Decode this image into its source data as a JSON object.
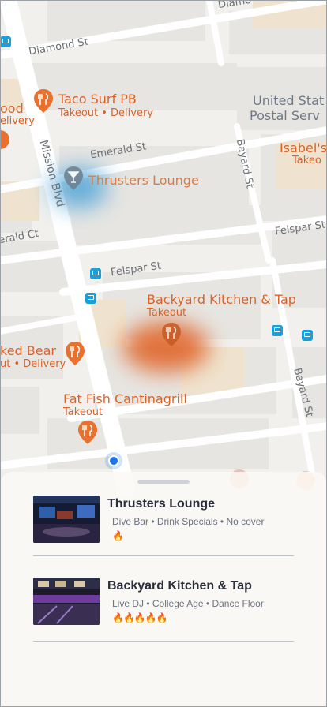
{
  "map": {
    "streets": {
      "diamond_top": "Diamo",
      "diamond": "Diamond St",
      "emerald": "Emerald St",
      "emerald_left": "erald Ct",
      "felspar": "Felspar St",
      "felspar_right": "Felspar St",
      "mission": "Mission Blvd",
      "bayard_top": "Bayard St",
      "bayard_bottom": "Bayard St"
    },
    "places": {
      "taco_surf": {
        "name": "Taco Surf PB",
        "sub": "Takeout • Delivery"
      },
      "usps": {
        "line1": "United Stat",
        "line2": "Postal Serv"
      },
      "isabels": {
        "name": "Isabel's",
        "sub": "Takeo"
      },
      "thrusters": {
        "name": "Thrusters Lounge"
      },
      "backyard": {
        "name": "Backyard Kitchen & Tap",
        "sub": "Takeout"
      },
      "naked_bear": {
        "name": "ked Bear",
        "sub": "ut • Delivery"
      },
      "fat_fish": {
        "name": "Fat Fish Cantinagrill",
        "sub": "Takeout"
      },
      "left_food": {
        "name": "ood",
        "sub": "elivery"
      }
    },
    "icons": {
      "restaurant": "fork-knife-icon",
      "bar": "cocktail-icon",
      "bus": "bus-stop-icon",
      "location": "current-location-icon"
    },
    "colors": {
      "food": "#e8712f",
      "transit": "#1a9fd8",
      "location": "#1a73e8",
      "heat_orange": "#e0662a",
      "heat_blue": "#3b9bd6"
    }
  },
  "sheet": {
    "venues": [
      {
        "name": "Thrusters Lounge",
        "tags": "Dive Bar • Drink Specials • No cover",
        "fire": "🔥",
        "fire_level": 1
      },
      {
        "name": "Backyard Kitchen & Tap",
        "tags": "Live DJ • College Age • Dance Floor",
        "fire": "🔥🔥🔥🔥🔥",
        "fire_level": 5
      }
    ]
  }
}
